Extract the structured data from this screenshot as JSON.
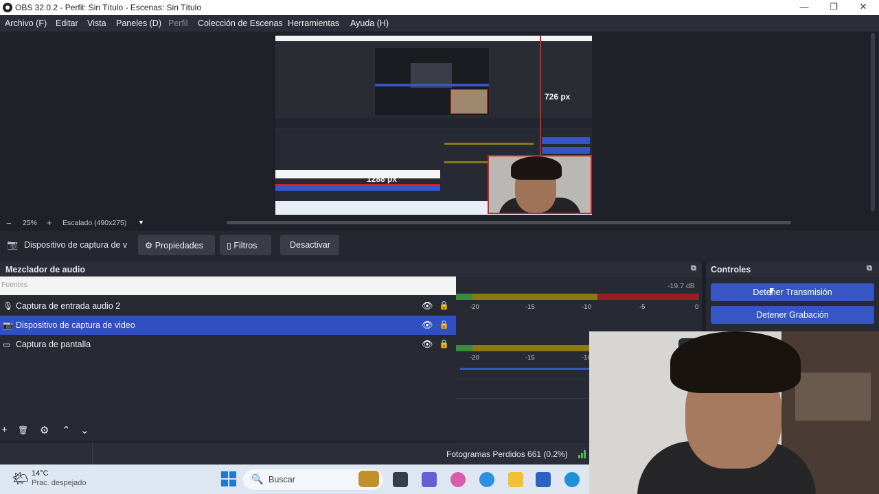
{
  "window": {
    "title": "OBS 32.0.2 - Perfil: Sin Título - Escenas: Sin Título",
    "minimize": "—",
    "restore": "❐",
    "close": "✕"
  },
  "menu": [
    {
      "label": "Archivo (F)",
      "enabled": true
    },
    {
      "label": "Editar",
      "enabled": true
    },
    {
      "label": "Vista",
      "enabled": true
    },
    {
      "label": "Paneles (D)",
      "enabled": true
    },
    {
      "label": "Perfil",
      "enabled": false
    },
    {
      "label": "Colección de Escenas",
      "enabled": true
    },
    {
      "label": "Herramientas",
      "enabled": true
    },
    {
      "label": "Ayuda (H)",
      "enabled": true
    }
  ],
  "preview": {
    "height_label": "726 px",
    "width_label": "1288 px"
  },
  "preview_toolbar": {
    "zoom_out": "−",
    "zoom": "25%",
    "zoom_in": "+",
    "scaling": "Escalado (490x275)",
    "dropdown_icon": "▼"
  },
  "source_toolbar": {
    "source_name": "Dispositivo de captura de v",
    "properties": "Propiedades",
    "filters": "Filtros",
    "deactivate": "Desactivar"
  },
  "mixer": {
    "title": "Mezclador de audio",
    "db_value": "-19.7 dB",
    "ticks": [
      "-20",
      "-15",
      "-10",
      "-5",
      "0"
    ],
    "ticks2": [
      "-20",
      "-15",
      "-10"
    ]
  },
  "controls": {
    "title": "Controles",
    "stop_stream": "Detener Transmisión",
    "stop_record": "Detener Grabación"
  },
  "sources": {
    "header": "Fuentes",
    "items": [
      {
        "label": "Captura de entrada audio 2",
        "icon": "microphone-icon",
        "selected": false
      },
      {
        "label": "Dispositivo de captura de video",
        "icon": "camera-icon",
        "selected": true
      },
      {
        "label": "Captura de pantalla",
        "icon": "monitor-icon",
        "selected": false
      }
    ],
    "footer": {
      "add": "+",
      "remove": "🗑",
      "settings": "⚙",
      "up": "⌃",
      "down": "⌄"
    }
  },
  "status": {
    "dropped_frames": "Fotogramas Perdidos 661 (0.2%)"
  },
  "taskbar": {
    "weather_temp": "14°C",
    "weather_desc": "Prac. despejado",
    "search_placeholder": "Buscar"
  },
  "colors": {
    "accent": "#3656c4",
    "meter_green": "#3a8b3a",
    "meter_yellow": "#8b7a10",
    "meter_red": "#9b1e1e",
    "red_guide": "#e01b1b"
  }
}
